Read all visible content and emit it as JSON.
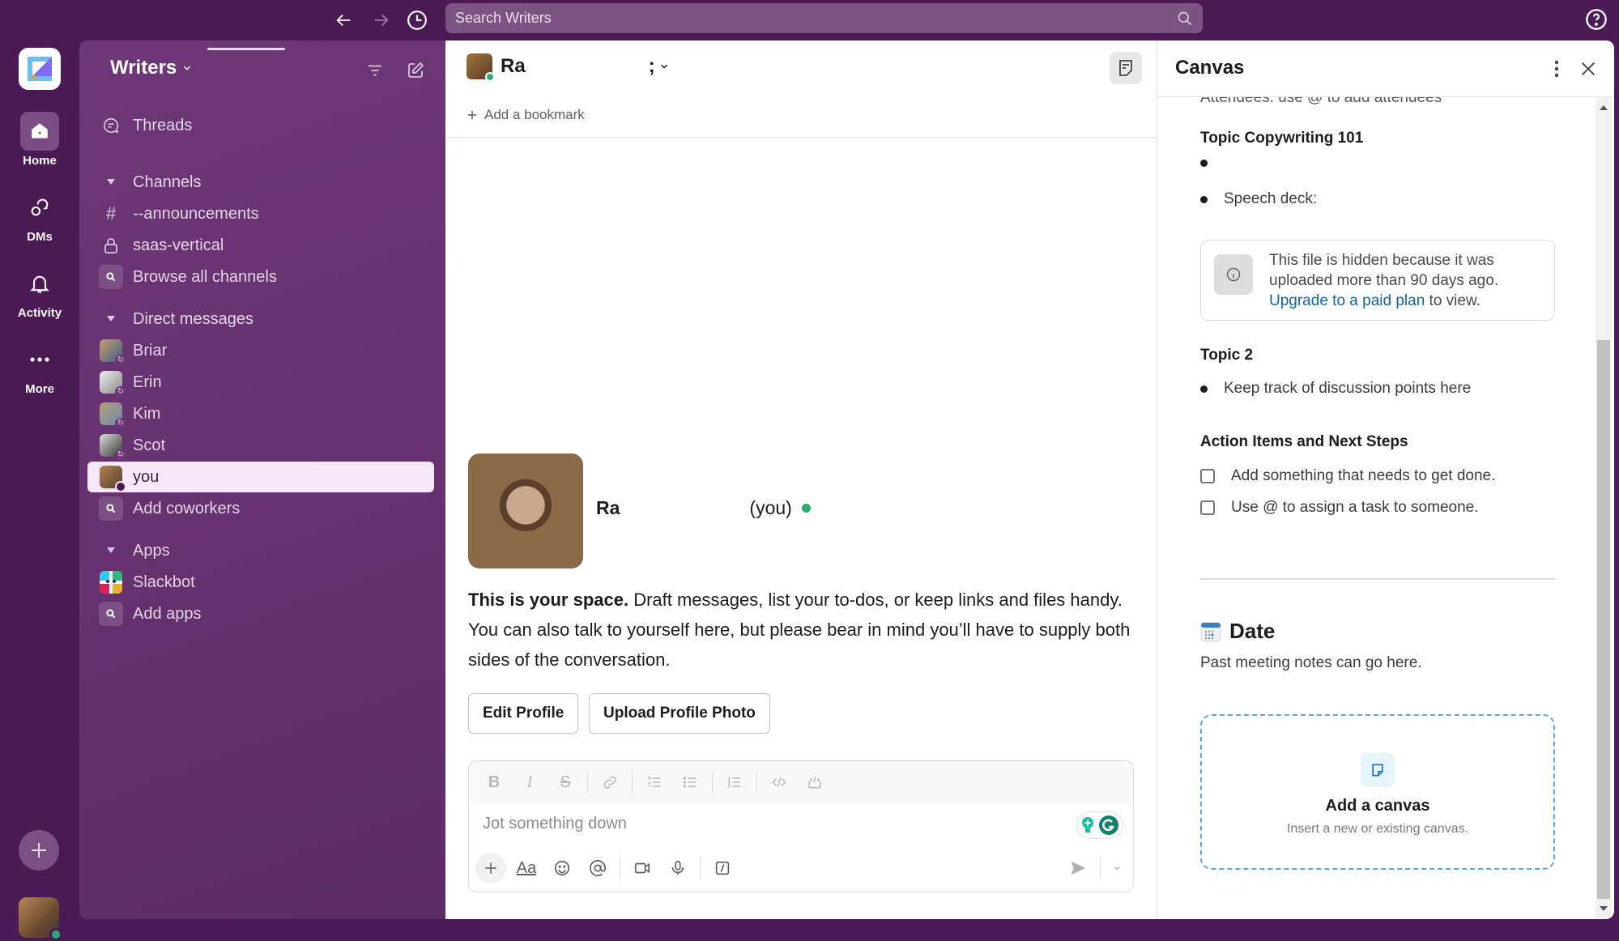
{
  "topbar": {
    "back_icon": "arrow-left",
    "forward_icon": "arrow-right",
    "history_icon": "clock",
    "search_placeholder": "Search Writers",
    "help_icon": "question-circle"
  },
  "rail": {
    "items": [
      {
        "label": "Home",
        "icon": "home",
        "active": true
      },
      {
        "label": "DMs",
        "icon": "dm-bubbles"
      },
      {
        "label": "Activity",
        "icon": "bell"
      },
      {
        "label": "More",
        "icon": "ellipsis"
      }
    ]
  },
  "sidebar": {
    "workspace_name": "Writers",
    "threads_label": "Threads",
    "channels_header": "Channels",
    "channels": [
      {
        "name": "--announcements",
        "icon": "hash"
      },
      {
        "name": "saas-vertical",
        "icon": "lock"
      }
    ],
    "browse_channels": "Browse all channels",
    "dms_header": "Direct messages",
    "dms": [
      {
        "name": "Briar"
      },
      {
        "name": "Erin"
      },
      {
        "name": "Kim"
      },
      {
        "name": "Scot"
      },
      {
        "name": "you",
        "selected": true
      }
    ],
    "add_coworkers": "Add coworkers",
    "apps_header": "Apps",
    "apps": [
      {
        "name": "Slackbot"
      }
    ],
    "add_apps": "Add apps"
  },
  "channel": {
    "title_start": "Ra",
    "title_end": ";",
    "add_bookmark": "Add a bookmark",
    "intro": {
      "name_start": "Ra",
      "you_label": "(you)",
      "bold": "This is your space.",
      "text": " Draft messages, list your to-dos, or keep links and files handy. You can also talk to yourself here, but please bear in mind you’ll have to supply both sides of the conversation."
    },
    "edit_profile": "Edit Profile",
    "upload_photo": "Upload Profile Photo",
    "composer": {
      "placeholder": "Jot something down",
      "format_buttons": [
        "B",
        "I",
        "S",
        "link",
        "ordered-list",
        "bullet-list",
        "blockquote",
        "code",
        "code-block"
      ],
      "actions": [
        "plus",
        "Aa",
        "emoji",
        "mention",
        "video",
        "mic",
        "slash"
      ]
    }
  },
  "canvas": {
    "title": "Canvas",
    "cut_line": "Attendees: use @ to add attendees",
    "topic1": "Topic Copywriting 101",
    "bullet_empty": "",
    "speech_deck": "Speech deck:",
    "hidden_file": {
      "line1": "This file is hidden because it was",
      "line2": "uploaded more than 90 days ago.",
      "link": "Upgrade to a paid plan",
      "after_link": " to view."
    },
    "topic2": "Topic 2",
    "topic2_bullet": "Keep track of discussion points here",
    "action_header": "Action Items and Next Steps",
    "tasks": [
      {
        "text": "Add something that needs to get done.",
        "checked": false
      },
      {
        "text": "Use @ to assign a task to someone.",
        "checked": false
      }
    ],
    "date_title": "Date",
    "date_text": "Past meeting notes can go here.",
    "add_canvas_title": "Add a canvas",
    "add_canvas_sub": "Insert a new or existing canvas."
  },
  "colors": {
    "aubergine": "#4b1a55",
    "sidebar": "#6e3778",
    "online": "#2bac76",
    "link": "#1264a3"
  }
}
